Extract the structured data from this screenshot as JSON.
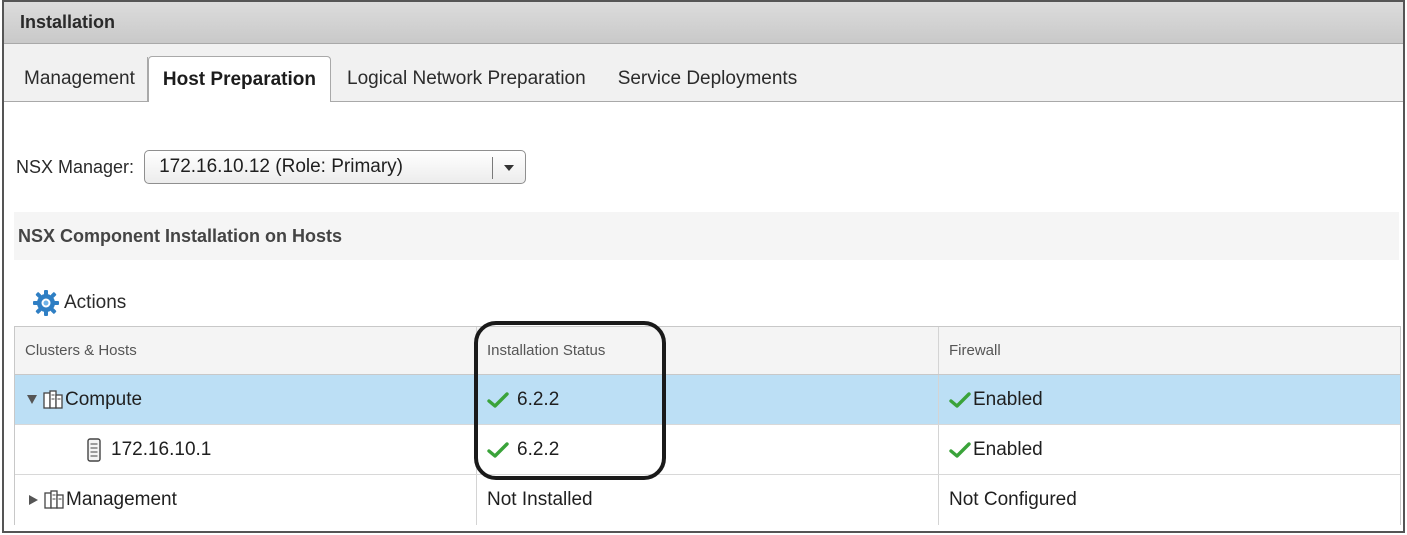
{
  "window": {
    "title": "Installation"
  },
  "tabs": [
    {
      "label": "Management",
      "active": false
    },
    {
      "label": "Host Preparation",
      "active": true
    },
    {
      "label": "Logical Network Preparation",
      "active": false
    },
    {
      "label": "Service Deployments",
      "active": false
    }
  ],
  "nsx_manager": {
    "label": "NSX Manager:",
    "selected": "172.16.10.12 (Role: Primary)"
  },
  "section": {
    "title": "NSX Component Installation on Hosts"
  },
  "toolbar": {
    "actions_label": "Actions",
    "actions_icon": "gear-icon"
  },
  "grid": {
    "columns": [
      "Clusters & Hosts",
      "Installation Status",
      "Firewall"
    ],
    "rows": [
      {
        "name": "Compute",
        "type": "cluster",
        "expanded": true,
        "selected": true,
        "install_status": "6.2.2",
        "install_ok": true,
        "firewall": "Enabled",
        "firewall_ok": true
      },
      {
        "name": "172.16.10.1",
        "type": "host",
        "expanded": false,
        "selected": false,
        "install_status": "6.2.2",
        "install_ok": true,
        "firewall": "Enabled",
        "firewall_ok": true
      },
      {
        "name": "Management",
        "type": "cluster",
        "expanded": false,
        "selected": false,
        "install_status": "Not Installed",
        "install_ok": false,
        "firewall": "Not Configured",
        "firewall_ok": false
      }
    ]
  },
  "colors": {
    "selected_row": "#bcdff5",
    "check": "#3aa33a",
    "gear": "#2f7fc4"
  }
}
